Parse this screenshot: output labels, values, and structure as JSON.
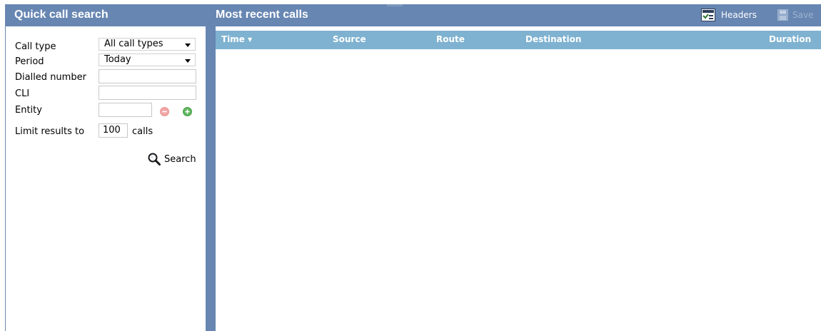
{
  "left_panel": {
    "title": "Quick call search",
    "fields": {
      "call_type": {
        "label": "Call type",
        "value": "All call types"
      },
      "period": {
        "label": "Period",
        "value": "Today"
      },
      "dialled_number": {
        "label": "Dialled number",
        "value": ""
      },
      "cli": {
        "label": "CLI",
        "value": ""
      },
      "entity": {
        "label": "Entity",
        "value": ""
      },
      "limit": {
        "label": "Limit results to",
        "value": "100",
        "suffix": "calls"
      }
    },
    "search_label": "Search"
  },
  "right_panel": {
    "title": "Most recent calls",
    "toolbar": {
      "headers_label": "Headers",
      "save_label": "Save"
    },
    "columns": [
      "Time",
      "Source",
      "Route",
      "Destination",
      "Duration"
    ],
    "sort_indicator": "▼",
    "rows": []
  },
  "colors": {
    "header_bg": "#6786b2",
    "column_header_bg": "#7fb2d0",
    "add_icon": "#5fb65f",
    "remove_icon": "#f2a6a6"
  },
  "icons": {
    "search": "search-icon",
    "headers": "headers-icon",
    "save": "save-icon",
    "remove": "remove-circle-icon",
    "add": "add-circle-icon"
  }
}
